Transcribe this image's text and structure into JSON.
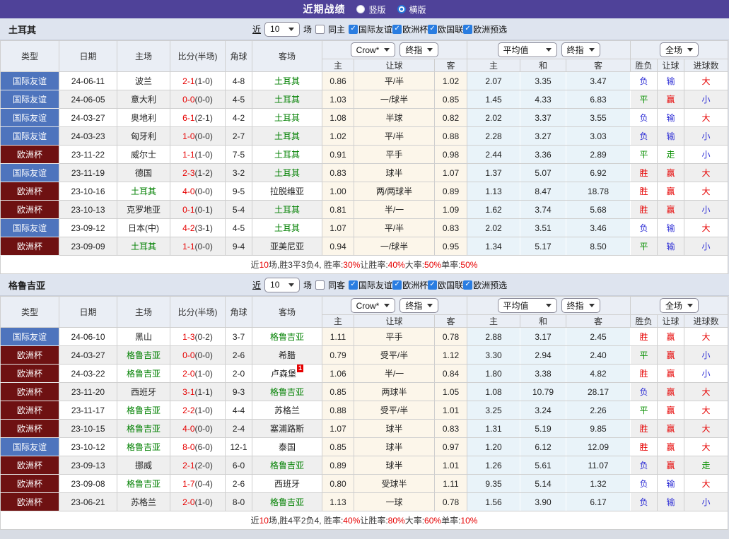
{
  "topbar": {
    "title": "近期战绩",
    "layout_options": [
      {
        "label": "竖版",
        "selected": false
      },
      {
        "label": "横版",
        "selected": true
      }
    ]
  },
  "filter": {
    "near_link": "近",
    "count_value": "10",
    "matches_label": "场",
    "competitions": [
      "国际友谊",
      "欧洲杯",
      "欧国联",
      "欧洲预选"
    ]
  },
  "columns": {
    "left": [
      "类型",
      "日期",
      "主场",
      "比分(半场)",
      "角球",
      "客场"
    ],
    "sub": [
      "主",
      "让球",
      "客",
      "主",
      "和",
      "客",
      "胜负",
      "让球",
      "进球数"
    ],
    "selects": {
      "company": "Crow*",
      "final1": "终指",
      "average": "平均值",
      "final2": "终指",
      "scope": "全场"
    }
  },
  "colors": {
    "accent_purple": "#4f4299",
    "badge_friendly": "#4e74bd",
    "badge_eurocup": "#6e1112",
    "team_green": "#008000",
    "score_red": "#e60000",
    "win_red": "#e60000",
    "lose_blue": "#2b2bd5",
    "draw_green": "#089000",
    "crow_bg": "#fcf6ea",
    "avg_bg": "#e9f3f9"
  },
  "sections": [
    {
      "team": "土耳其",
      "same_venue_label": "同主",
      "rows": [
        {
          "comp": "国际友谊",
          "cc": "blue",
          "date": "24-06-11",
          "home": "波兰",
          "home_team": false,
          "home_rc": 0,
          "score": "2-1",
          "half": "(1-0)",
          "corner": "4-8",
          "away": "土耳其",
          "away_team": true,
          "away_rc": 0,
          "crow": [
            "0.86",
            "平/半",
            "1.02"
          ],
          "avg": [
            "2.07",
            "3.35",
            "3.47"
          ],
          "res": [
            [
              "负",
              "b"
            ],
            [
              "输",
              "b"
            ],
            [
              "大",
              "r"
            ]
          ]
        },
        {
          "comp": "国际友谊",
          "cc": "blue",
          "date": "24-06-05",
          "home": "意大利",
          "home_team": false,
          "home_rc": 0,
          "score": "0-0",
          "half": "(0-0)",
          "corner": "4-5",
          "away": "土耳其",
          "away_team": true,
          "away_rc": 0,
          "crow": [
            "1.03",
            "一/球半",
            "0.85"
          ],
          "avg": [
            "1.45",
            "4.33",
            "6.83"
          ],
          "res": [
            [
              "平",
              "g"
            ],
            [
              "赢",
              "r"
            ],
            [
              "小",
              "b"
            ]
          ]
        },
        {
          "comp": "国际友谊",
          "cc": "blue",
          "date": "24-03-27",
          "home": "奥地利",
          "home_team": false,
          "home_rc": 0,
          "score": "6-1",
          "half": "(2-1)",
          "corner": "4-2",
          "away": "土耳其",
          "away_team": true,
          "away_rc": 0,
          "crow": [
            "1.08",
            "半球",
            "0.82"
          ],
          "avg": [
            "2.02",
            "3.37",
            "3.55"
          ],
          "res": [
            [
              "负",
              "b"
            ],
            [
              "输",
              "b"
            ],
            [
              "大",
              "r"
            ]
          ]
        },
        {
          "comp": "国际友谊",
          "cc": "blue",
          "date": "24-03-23",
          "home": "匈牙利",
          "home_team": false,
          "home_rc": 0,
          "score": "1-0",
          "half": "(0-0)",
          "corner": "2-7",
          "away": "土耳其",
          "away_team": true,
          "away_rc": 0,
          "crow": [
            "1.02",
            "平/半",
            "0.88"
          ],
          "avg": [
            "2.28",
            "3.27",
            "3.03"
          ],
          "res": [
            [
              "负",
              "b"
            ],
            [
              "输",
              "b"
            ],
            [
              "小",
              "b"
            ]
          ]
        },
        {
          "comp": "欧洲杯",
          "cc": "maroon",
          "date": "23-11-22",
          "home": "威尔士",
          "home_team": false,
          "home_rc": 0,
          "score": "1-1",
          "half": "(1-0)",
          "corner": "7-5",
          "away": "土耳其",
          "away_team": true,
          "away_rc": 0,
          "crow": [
            "0.91",
            "平手",
            "0.98"
          ],
          "avg": [
            "2.44",
            "3.36",
            "2.89"
          ],
          "res": [
            [
              "平",
              "g"
            ],
            [
              "走",
              "g"
            ],
            [
              "小",
              "b"
            ]
          ]
        },
        {
          "comp": "国际友谊",
          "cc": "blue",
          "date": "23-11-19",
          "home": "德国",
          "home_team": false,
          "home_rc": 0,
          "score": "2-3",
          "half": "(1-2)",
          "corner": "3-2",
          "away": "土耳其",
          "away_team": true,
          "away_rc": 0,
          "crow": [
            "0.83",
            "球半",
            "1.07"
          ],
          "avg": [
            "1.37",
            "5.07",
            "6.92"
          ],
          "res": [
            [
              "胜",
              "r"
            ],
            [
              "赢",
              "r"
            ],
            [
              "大",
              "r"
            ]
          ]
        },
        {
          "comp": "欧洲杯",
          "cc": "maroon",
          "date": "23-10-16",
          "home": "土耳其",
          "home_team": true,
          "home_rc": 0,
          "score": "4-0",
          "half": "(0-0)",
          "corner": "9-5",
          "away": "拉脱维亚",
          "away_team": false,
          "away_rc": 0,
          "crow": [
            "1.00",
            "两/两球半",
            "0.89"
          ],
          "avg": [
            "1.13",
            "8.47",
            "18.78"
          ],
          "res": [
            [
              "胜",
              "r"
            ],
            [
              "赢",
              "r"
            ],
            [
              "大",
              "r"
            ]
          ]
        },
        {
          "comp": "欧洲杯",
          "cc": "maroon",
          "date": "23-10-13",
          "home": "克罗地亚",
          "home_team": false,
          "home_rc": 0,
          "score": "0-1",
          "half": "(0-1)",
          "corner": "5-4",
          "away": "土耳其",
          "away_team": true,
          "away_rc": 0,
          "crow": [
            "0.81",
            "半/一",
            "1.09"
          ],
          "avg": [
            "1.62",
            "3.74",
            "5.68"
          ],
          "res": [
            [
              "胜",
              "r"
            ],
            [
              "赢",
              "r"
            ],
            [
              "小",
              "b"
            ]
          ]
        },
        {
          "comp": "国际友谊",
          "cc": "blue",
          "date": "23-09-12",
          "home": "日本(中)",
          "home_team": false,
          "home_rc": 0,
          "score": "4-2",
          "half": "(3-1)",
          "corner": "4-5",
          "away": "土耳其",
          "away_team": true,
          "away_rc": 0,
          "crow": [
            "1.07",
            "平/半",
            "0.83"
          ],
          "avg": [
            "2.02",
            "3.51",
            "3.46"
          ],
          "res": [
            [
              "负",
              "b"
            ],
            [
              "输",
              "b"
            ],
            [
              "大",
              "r"
            ]
          ]
        },
        {
          "comp": "欧洲杯",
          "cc": "maroon",
          "date": "23-09-09",
          "home": "土耳其",
          "home_team": true,
          "home_rc": 0,
          "score": "1-1",
          "half": "(0-0)",
          "corner": "9-4",
          "away": "亚美尼亚",
          "away_team": false,
          "away_rc": 0,
          "crow": [
            "0.94",
            "一/球半",
            "0.95"
          ],
          "avg": [
            "1.34",
            "5.17",
            "8.50"
          ],
          "res": [
            [
              "平",
              "g"
            ],
            [
              "输",
              "b"
            ],
            [
              "小",
              "b"
            ]
          ]
        }
      ],
      "summary": [
        {
          "t": "近"
        },
        {
          "t": "10",
          "red": true
        },
        {
          "t": "场,胜3平3负4, 胜率:"
        },
        {
          "t": "30%",
          "red": true
        },
        {
          "t": " 让胜率:"
        },
        {
          "t": "40%",
          "red": true
        },
        {
          "t": " 大率:"
        },
        {
          "t": "50%",
          "red": true
        },
        {
          "t": " 单率:"
        },
        {
          "t": "50%",
          "red": true
        }
      ]
    },
    {
      "team": "格鲁吉亚",
      "same_venue_label": "同客",
      "rows": [
        {
          "comp": "国际友谊",
          "cc": "blue",
          "date": "24-06-10",
          "home": "黑山",
          "home_team": false,
          "home_rc": 0,
          "score": "1-3",
          "half": "(0-2)",
          "corner": "3-7",
          "away": "格鲁吉亚",
          "away_team": true,
          "away_rc": 0,
          "crow": [
            "1.11",
            "平手",
            "0.78"
          ],
          "avg": [
            "2.88",
            "3.17",
            "2.45"
          ],
          "res": [
            [
              "胜",
              "r"
            ],
            [
              "赢",
              "r"
            ],
            [
              "大",
              "r"
            ]
          ]
        },
        {
          "comp": "欧洲杯",
          "cc": "maroon",
          "date": "24-03-27",
          "home": "格鲁吉亚",
          "home_team": true,
          "home_rc": 0,
          "score": "0-0",
          "half": "(0-0)",
          "corner": "2-6",
          "away": "希腊",
          "away_team": false,
          "away_rc": 0,
          "crow": [
            "0.79",
            "受平/半",
            "1.12"
          ],
          "avg": [
            "3.30",
            "2.94",
            "2.40"
          ],
          "res": [
            [
              "平",
              "g"
            ],
            [
              "赢",
              "r"
            ],
            [
              "小",
              "b"
            ]
          ]
        },
        {
          "comp": "欧洲杯",
          "cc": "maroon",
          "date": "24-03-22",
          "home": "格鲁吉亚",
          "home_team": true,
          "home_rc": 0,
          "score": "2-0",
          "half": "(1-0)",
          "corner": "2-0",
          "away": "卢森堡",
          "away_team": false,
          "away_rc": 1,
          "crow": [
            "1.06",
            "半/一",
            "0.84"
          ],
          "avg": [
            "1.80",
            "3.38",
            "4.82"
          ],
          "res": [
            [
              "胜",
              "r"
            ],
            [
              "赢",
              "r"
            ],
            [
              "小",
              "b"
            ]
          ]
        },
        {
          "comp": "欧洲杯",
          "cc": "maroon",
          "date": "23-11-20",
          "home": "西班牙",
          "home_team": false,
          "home_rc": 0,
          "score": "3-1",
          "half": "(1-1)",
          "corner": "9-3",
          "away": "格鲁吉亚",
          "away_team": true,
          "away_rc": 0,
          "crow": [
            "0.85",
            "两球半",
            "1.05"
          ],
          "avg": [
            "1.08",
            "10.79",
            "28.17"
          ],
          "res": [
            [
              "负",
              "b"
            ],
            [
              "赢",
              "r"
            ],
            [
              "大",
              "r"
            ]
          ]
        },
        {
          "comp": "欧洲杯",
          "cc": "maroon",
          "date": "23-11-17",
          "home": "格鲁吉亚",
          "home_team": true,
          "home_rc": 0,
          "score": "2-2",
          "half": "(1-0)",
          "corner": "4-4",
          "away": "苏格兰",
          "away_team": false,
          "away_rc": 0,
          "crow": [
            "0.88",
            "受平/半",
            "1.01"
          ],
          "avg": [
            "3.25",
            "3.24",
            "2.26"
          ],
          "res": [
            [
              "平",
              "g"
            ],
            [
              "赢",
              "r"
            ],
            [
              "大",
              "r"
            ]
          ]
        },
        {
          "comp": "欧洲杯",
          "cc": "maroon",
          "date": "23-10-15",
          "home": "格鲁吉亚",
          "home_team": true,
          "home_rc": 0,
          "score": "4-0",
          "half": "(0-0)",
          "corner": "2-4",
          "away": "塞浦路斯",
          "away_team": false,
          "away_rc": 0,
          "crow": [
            "1.07",
            "球半",
            "0.83"
          ],
          "avg": [
            "1.31",
            "5.19",
            "9.85"
          ],
          "res": [
            [
              "胜",
              "r"
            ],
            [
              "赢",
              "r"
            ],
            [
              "大",
              "r"
            ]
          ]
        },
        {
          "comp": "国际友谊",
          "cc": "blue",
          "date": "23-10-12",
          "home": "格鲁吉亚",
          "home_team": true,
          "home_rc": 0,
          "score": "8-0",
          "half": "(6-0)",
          "corner": "12-1",
          "away": "泰国",
          "away_team": false,
          "away_rc": 0,
          "crow": [
            "0.85",
            "球半",
            "0.97"
          ],
          "avg": [
            "1.20",
            "6.12",
            "12.09"
          ],
          "res": [
            [
              "胜",
              "r"
            ],
            [
              "赢",
              "r"
            ],
            [
              "大",
              "r"
            ]
          ]
        },
        {
          "comp": "欧洲杯",
          "cc": "maroon",
          "date": "23-09-13",
          "home": "挪威",
          "home_team": false,
          "home_rc": 0,
          "score": "2-1",
          "half": "(2-0)",
          "corner": "6-0",
          "away": "格鲁吉亚",
          "away_team": true,
          "away_rc": 0,
          "crow": [
            "0.89",
            "球半",
            "1.01"
          ],
          "avg": [
            "1.26",
            "5.61",
            "11.07"
          ],
          "res": [
            [
              "负",
              "b"
            ],
            [
              "赢",
              "r"
            ],
            [
              "走",
              "g"
            ]
          ]
        },
        {
          "comp": "欧洲杯",
          "cc": "maroon",
          "date": "23-09-08",
          "home": "格鲁吉亚",
          "home_team": true,
          "home_rc": 0,
          "score": "1-7",
          "half": "(0-4)",
          "corner": "2-6",
          "away": "西班牙",
          "away_team": false,
          "away_rc": 0,
          "crow": [
            "0.80",
            "受球半",
            "1.11"
          ],
          "avg": [
            "9.35",
            "5.14",
            "1.32"
          ],
          "res": [
            [
              "负",
              "b"
            ],
            [
              "输",
              "b"
            ],
            [
              "大",
              "r"
            ]
          ]
        },
        {
          "comp": "欧洲杯",
          "cc": "maroon",
          "date": "23-06-21",
          "home": "苏格兰",
          "home_team": false,
          "home_rc": 0,
          "score": "2-0",
          "half": "(1-0)",
          "corner": "8-0",
          "away": "格鲁吉亚",
          "away_team": true,
          "away_rc": 0,
          "crow": [
            "1.13",
            "一球",
            "0.78"
          ],
          "avg": [
            "1.56",
            "3.90",
            "6.17"
          ],
          "res": [
            [
              "负",
              "b"
            ],
            [
              "输",
              "b"
            ],
            [
              "小",
              "b"
            ]
          ]
        }
      ],
      "summary": [
        {
          "t": "近"
        },
        {
          "t": "10",
          "red": true
        },
        {
          "t": "场,胜4平2负4, 胜率:"
        },
        {
          "t": "40%",
          "red": true
        },
        {
          "t": " 让胜率:"
        },
        {
          "t": "80%",
          "red": true
        },
        {
          "t": " 大率:"
        },
        {
          "t": "60%",
          "red": true
        },
        {
          "t": " 单率:"
        },
        {
          "t": "10%",
          "red": true
        }
      ]
    }
  ]
}
